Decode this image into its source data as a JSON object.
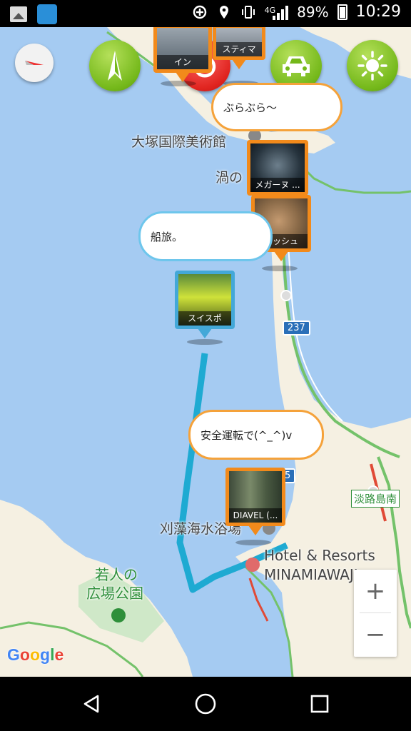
{
  "status_bar": {
    "network_type": "4G",
    "battery_percent": "89%",
    "time": "10:29"
  },
  "map_controls": {
    "compass_icon": "compass-needle-icon",
    "navigate_icon": "navigation-arrow-icon",
    "power_icon": "power-icon",
    "car_icon": "car-icon",
    "brightness_icon": "sun-icon"
  },
  "pins": [
    {
      "caption": "イン",
      "color": "#f28a1b"
    },
    {
      "caption": "スティマ",
      "color": "#f28a1b"
    },
    {
      "caption": "メガーヌ ...",
      "color": "#f28a1b"
    },
    {
      "caption": "イッシュ",
      "color": "#f28a1b"
    },
    {
      "caption": "スイスポ",
      "color": "#43a8d8"
    },
    {
      "caption": "DIAVEL (...",
      "color": "#f28a1b"
    }
  ],
  "bubbles": [
    {
      "text": "ぶらぶら～"
    },
    {
      "text": "船旅。"
    },
    {
      "text": "安全運転で(^_^)v"
    }
  ],
  "map_labels": {
    "museum": "大塚国際美術館",
    "uzu": "渦の",
    "beach": "刈藻海水浴場",
    "hotel_line1": "Hotel & Resorts",
    "hotel_line2": "MINAMIAWAJI",
    "awaji_south": "淡路島南",
    "park_line1": "若人の",
    "park_line2": "広場公園",
    "route_237": "237",
    "route_partial": "5"
  },
  "zoom": {
    "in": "+",
    "out": "−"
  },
  "attribution": "Google",
  "nav_bar": {
    "back_icon": "back-triangle-icon",
    "home_icon": "home-circle-icon",
    "recents_icon": "recents-square-icon"
  }
}
